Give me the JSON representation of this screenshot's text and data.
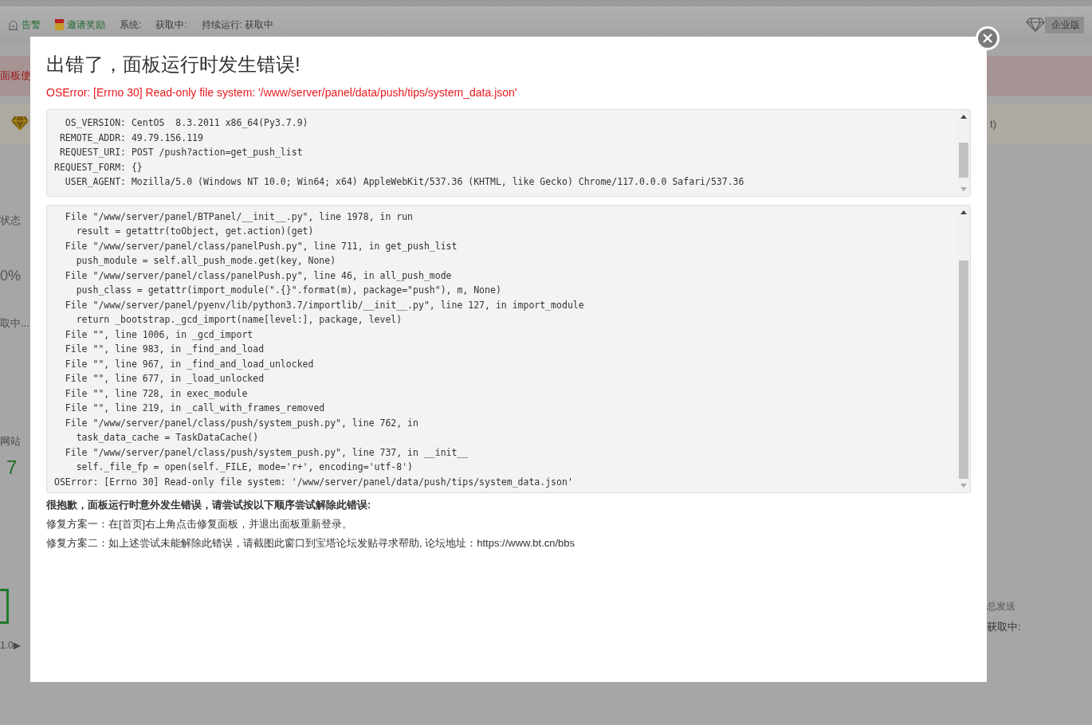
{
  "top_bar": {
    "items": [
      {
        "kind": "alert",
        "label": "告警"
      },
      {
        "kind": "gift",
        "label": "邀请奖励"
      },
      {
        "kind": "text",
        "label": "系统:"
      },
      {
        "kind": "text",
        "label": "获取中:"
      },
      {
        "kind": "text",
        "label": "持续运行: 获取中"
      }
    ],
    "edition": "企业版"
  },
  "background": {
    "alert_banner": "面板使",
    "notice_banner": "t)",
    "left": [
      {
        "kind": "label",
        "text": "状态"
      },
      {
        "kind": "gauge",
        "text": "0%"
      },
      {
        "kind": "label",
        "text": "取中..."
      },
      {
        "kind": "label",
        "text": "网站"
      },
      {
        "kind": "count",
        "text": "7"
      },
      {
        "kind": "label",
        "text": "1.0▶"
      }
    ],
    "right": [
      {
        "kind": "label",
        "text": "总发送"
      },
      {
        "kind": "value",
        "text": "获取中:"
      }
    ]
  },
  "dialog": {
    "title": "出错了，面板运行时发生错误!",
    "error": "OSError: [Errno 30] Read-only file system: '/www/server/panel/data/push/tips/system_data.json'",
    "env_lines": [
      "  OS_VERSION: CentOS  8.3.2011 x86_64(Py3.7.9)",
      " REMOTE_ADDR: 49.79.156.119",
      " REQUEST_URI: POST /push?action=get_push_list",
      "REQUEST_FORM: {}",
      "  USER_AGENT: Mozilla/5.0 (Windows NT 10.0; Win64; x64) AppleWebKit/537.36 (KHTML, like Gecko) Chrome/117.0.0.0 Safari/537.36"
    ],
    "traceback_lines": [
      "  File \"/www/server/panel/BTPanel/__init__.py\", line 1978, in run",
      "    result = getattr(toObject, get.action)(get)",
      "  File \"/www/server/panel/class/panelPush.py\", line 711, in get_push_list",
      "    push_module = self.all_push_mode.get(key, None)",
      "  File \"/www/server/panel/class/panelPush.py\", line 46, in all_push_mode",
      "    push_class = getattr(import_module(\".{}\".format(m), package=\"push\"), m, None)",
      "  File \"/www/server/panel/pyenv/lib/python3.7/importlib/__init__.py\", line 127, in import_module",
      "    return _bootstrap._gcd_import(name[level:], package, level)",
      "  File \"\", line 1006, in _gcd_import",
      "  File \"\", line 983, in _find_and_load",
      "  File \"\", line 967, in _find_and_load_unlocked",
      "  File \"\", line 677, in _load_unlocked",
      "  File \"\", line 728, in exec_module",
      "  File \"\", line 219, in _call_with_frames_removed",
      "  File \"/www/server/panel/class/push/system_push.py\", line 762, in",
      "    task_data_cache = TaskDataCache()",
      "  File \"/www/server/panel/class/push/system_push.py\", line 737, in __init__",
      "    self._file_fp = open(self._FILE, mode='r+', encoding='utf-8')",
      "OSError: [Errno 30] Read-only file system: '/www/server/panel/data/push/tips/system_data.json'"
    ],
    "help_title": "很抱歉，面板运行时意外发生错误，请尝试按以下顺序尝试解除此错误:",
    "help_lines": [
      "修复方案一：在[首页]右上角点击修复面板，并退出面板重新登录。",
      "修复方案二：如上述尝试未能解除此错误，请截图此窗口到宝塔论坛发贴寻求帮助, 论坛地址：https://www.bt.cn/bbs"
    ]
  }
}
